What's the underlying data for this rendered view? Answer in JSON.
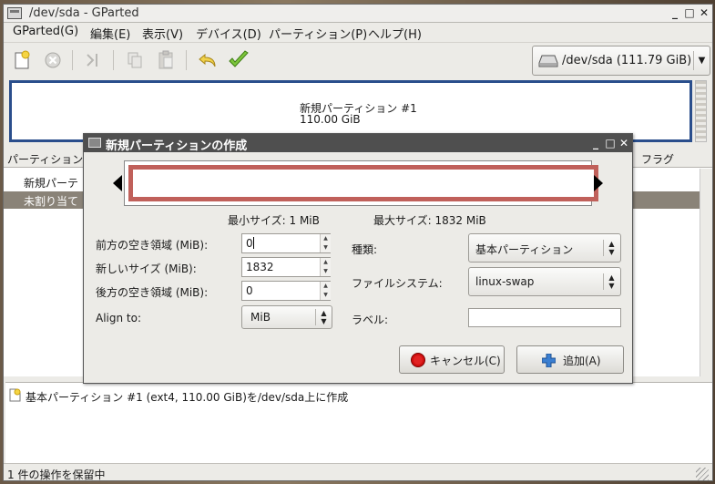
{
  "window": {
    "title": "/dev/sda - GParted"
  },
  "menubar": {
    "items": [
      "GParted(G)",
      "編集(E)",
      "表示(V)",
      "デバイス(D)",
      "パーティション(P)",
      "ヘルプ(H)"
    ]
  },
  "toolbar": {
    "buttons": [
      "new-icon",
      "delete-icon",
      "resize-move-icon",
      "copy-icon",
      "paste-icon",
      "undo-icon",
      "apply-icon"
    ]
  },
  "device": {
    "label": "/dev/sda  (111.79 GiB)"
  },
  "disk_map": {
    "partition_name": "新規パーティション #1",
    "partition_size": "110.00 GiB"
  },
  "table": {
    "columns": [
      "パーティション",
      "フラグ"
    ],
    "rows": [
      {
        "name": "新規パーテ"
      },
      {
        "name": "未割り当て"
      }
    ]
  },
  "operations": {
    "items": [
      "基本パーティション #1 (ext4, 110.00 GiB)を/dev/sda上に作成"
    ]
  },
  "status": {
    "text": "1 件の操作を保留中"
  },
  "dialog": {
    "title": "新規パーティションの作成",
    "min_size": "最小サイズ: 1 MiB",
    "max_size": "最大サイズ: 1832 MiB",
    "fields": {
      "free_before": {
        "label": "前方の空き領域 (MiB):",
        "value": "0"
      },
      "new_size": {
        "label": "新しいサイズ (MiB):",
        "value": "1832"
      },
      "free_after": {
        "label": "後方の空き領域 (MiB):",
        "value": "0"
      },
      "align": {
        "label": "Align to:",
        "value": "MiB"
      }
    },
    "type": {
      "label": "種類:",
      "value": "基本パーティション"
    },
    "filesystem": {
      "label": "ファイルシステム:",
      "value": "linux-swap"
    },
    "label_field": {
      "label": "ラベル:",
      "value": ""
    },
    "buttons": {
      "cancel": "キャンセル(C)",
      "add": "追加(A)"
    },
    "colors": {
      "partition_border": "#c0605a"
    }
  }
}
